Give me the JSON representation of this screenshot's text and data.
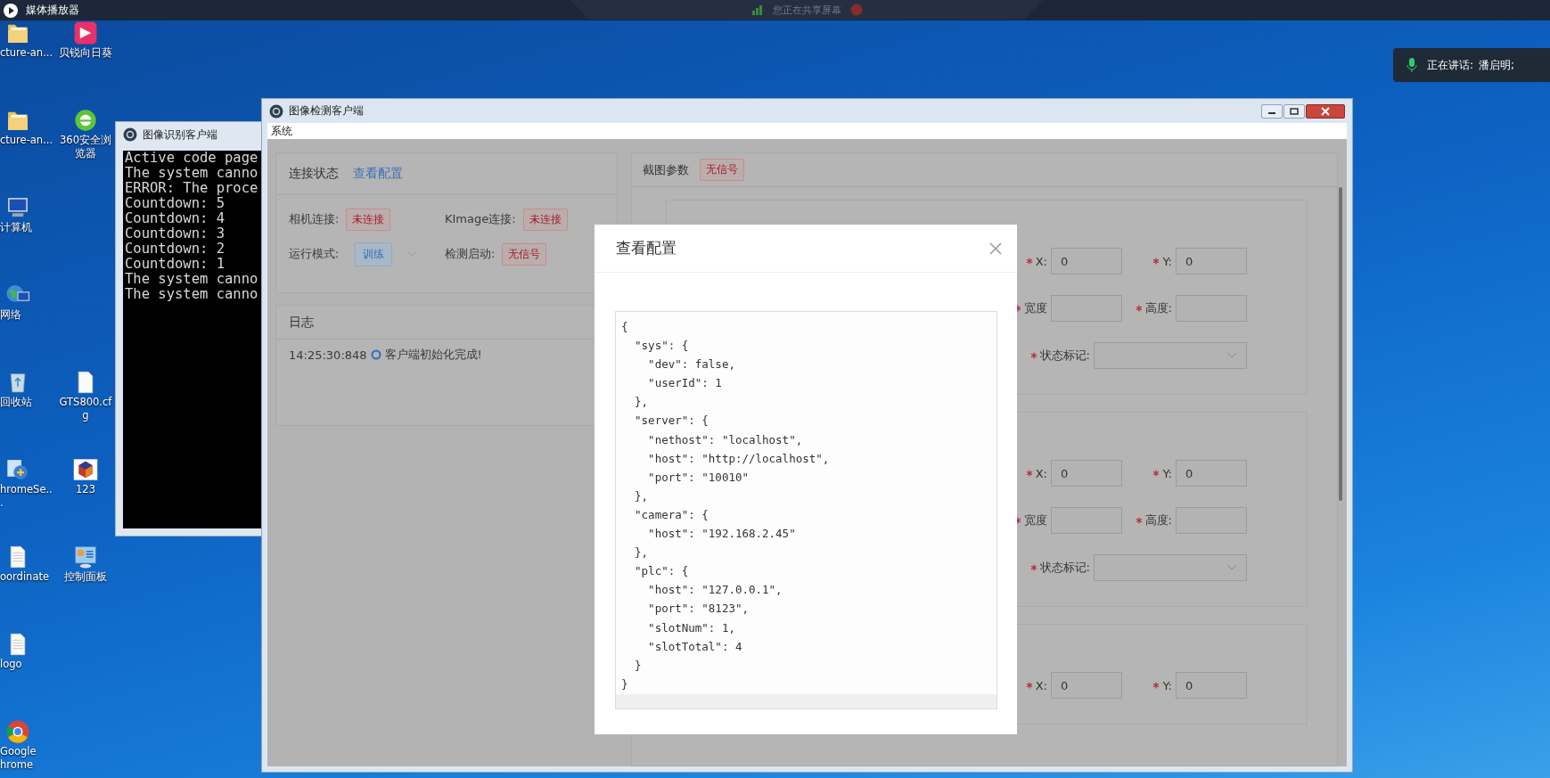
{
  "top_bar": {
    "title": "媒体播放器",
    "share_notice": "您正在共享屏幕"
  },
  "speaker_panel": {
    "label": "正在讲话:",
    "name": "潘启明;"
  },
  "desktop_icon_rows": [
    {
      "icons": [
        {
          "kind": "folder",
          "label": "cture-an..."
        },
        {
          "kind": "app",
          "label": "贝锐向日葵"
        }
      ]
    },
    {
      "icons": [
        {
          "kind": "folder",
          "label": "cture-an..."
        },
        {
          "kind": "browser",
          "label": "360安全浏览器"
        }
      ]
    },
    {
      "icons": [
        {
          "kind": "computer",
          "label": "计算机"
        }
      ]
    },
    {
      "icons": [
        {
          "kind": "network",
          "label": "网络"
        }
      ]
    },
    {
      "icons": [
        {
          "kind": "recycle-bin",
          "label": "回收站"
        },
        {
          "kind": "file",
          "label": "GTS800.cfg"
        }
      ]
    },
    {
      "icons": [
        {
          "kind": "installer",
          "label": "hromeSe..."
        },
        {
          "kind": "cube",
          "label": "123"
        }
      ]
    },
    {
      "icons": [
        {
          "kind": "document",
          "label": "oordinate"
        },
        {
          "kind": "control-panel",
          "label": "控制面板"
        }
      ]
    },
    {
      "icons": [
        {
          "kind": "document",
          "label": "logo"
        }
      ]
    },
    {
      "icons": [
        {
          "kind": "chrome",
          "label": "Google hrome"
        }
      ]
    }
  ],
  "console_window": {
    "title": "图像识别客户端",
    "lines": [
      "Active code page",
      "The system canno",
      "ERROR: The proce",
      "Countdown: 5",
      "Countdown: 4",
      "Countdown: 3",
      "Countdown: 2",
      "Countdown: 1",
      "The system canno",
      "The system canno"
    ]
  },
  "main_window": {
    "title": "图像检测客户端",
    "menu": [
      "系统"
    ],
    "connection_panel": {
      "title": "连接状态",
      "link": "查看配置",
      "items": [
        {
          "label": "相机连接:",
          "value": "未连接",
          "kind": "tag"
        },
        {
          "label": "KImage连接:",
          "value": "未连接",
          "kind": "tag"
        },
        {
          "label": "运行模式:",
          "value": "训练",
          "kind": "select"
        },
        {
          "label": "检测启动:",
          "value": "无信号",
          "kind": "tag"
        }
      ]
    },
    "log_panel": {
      "title": "日志",
      "entries": [
        {
          "time": "14:25:30:848",
          "message": "客户端初始化完成!"
        }
      ]
    },
    "capture_panel": {
      "title": "截图参数",
      "status": "无信号",
      "cards": [
        {
          "rows": [
            {
              "fields": [
                {
                  "label": "X:",
                  "value": "0",
                  "kind": "input",
                  "required": true
                },
                {
                  "label": "Y:",
                  "value": "0",
                  "kind": "input",
                  "required": true
                }
              ]
            },
            {
              "fields": [
                {
                  "label": "宽度",
                  "kind": "input",
                  "required": true
                },
                {
                  "label": "高度:",
                  "kind": "input",
                  "required": true
                }
              ]
            },
            {
              "fields": [
                {
                  "label": "状态标记:",
                  "kind": "select",
                  "required": true
                }
              ]
            }
          ]
        },
        {
          "rows": [
            {
              "fields": [
                {
                  "label": "X:",
                  "value": "0",
                  "kind": "input",
                  "required": true
                },
                {
                  "label": "Y:",
                  "value": "0",
                  "kind": "input",
                  "required": true
                }
              ]
            },
            {
              "fields": [
                {
                  "label": "宽度",
                  "kind": "input",
                  "required": true
                },
                {
                  "label": "高度:",
                  "kind": "input",
                  "required": true
                }
              ]
            },
            {
              "fields": [
                {
                  "label": "状态标记:",
                  "kind": "select",
                  "required": true
                }
              ]
            }
          ]
        },
        {
          "rows": [
            {
              "fields": [
                {
                  "label": "X:",
                  "value": "0",
                  "kind": "input",
                  "required": true
                },
                {
                  "label": "Y:",
                  "value": "0",
                  "kind": "input",
                  "required": true
                }
              ]
            }
          ]
        }
      ]
    }
  },
  "dialog": {
    "title": "查看配置",
    "code_lines": [
      "{",
      "  \"sys\": {",
      "    \"dev\": false,",
      "    \"userId\": 1",
      "  },",
      "  \"server\": {",
      "    \"nethost\": \"localhost\",",
      "    \"host\": \"http://localhost\",",
      "    \"port\": \"10010\"",
      "  },",
      "  \"camera\": {",
      "    \"host\": \"192.168.2.45\"",
      "  },",
      "  \"plc\": {",
      "    \"host\": \"127.0.0.1\",",
      "    \"port\": \"8123\",",
      "    \"slotNum\": 1,",
      "    \"slotTotal\": 4",
      "  }",
      "}"
    ]
  }
}
